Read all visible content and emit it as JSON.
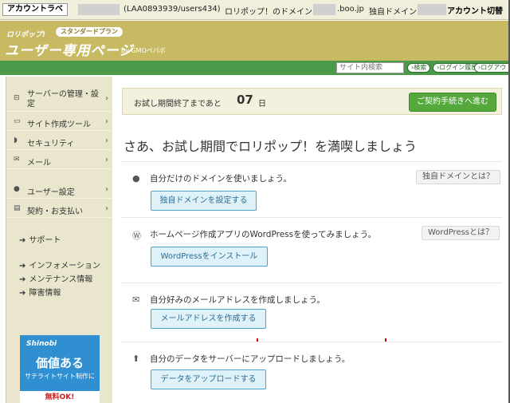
{
  "account_bar": {
    "tag": "アカウントラベ",
    "path": "(LAA0893939/users434)",
    "domain_label": "ロリポップ！のドメイン",
    "domain_suffix": ".boo.jp",
    "own_domain_label": "独自ドメイン",
    "switch_label": "アカウント切替"
  },
  "header": {
    "logo_small": "ロリポップ!",
    "plan_badge": "スタンダードプラン",
    "logo_main": "ユーザー専用ページ",
    "logo_gmo": "by GMOペパボ"
  },
  "toolbar": {
    "search_placeholder": "サイト内検索",
    "search_button": "検索",
    "login_history_button": "ログイン履歴",
    "logout_button": "ログアウト"
  },
  "sidebar": {
    "items": [
      {
        "icon": "server-icon",
        "label": "サーバーの管理・設定"
      },
      {
        "icon": "monitor-icon",
        "label": "サイト作成ツール"
      },
      {
        "icon": "shield-icon",
        "label": "セキュリティ"
      },
      {
        "icon": "mail-icon",
        "label": "メール"
      },
      {
        "icon": "user-icon",
        "label": "ユーザー設定"
      },
      {
        "icon": "card-icon",
        "label": "契約・お支払い"
      }
    ],
    "links": [
      "サポート",
      "インフォメーション",
      "メンテナンス情報",
      "障害情報"
    ],
    "banner": {
      "logo": "Shinobi",
      "title": "価値ある",
      "sub": "サテライトサイト制作に",
      "bottom": "無料OK!"
    }
  },
  "main": {
    "trial": {
      "label": "お試し期間終了まであと",
      "days": "07",
      "unit": "日",
      "contract_button": "ご契約手続きへ進む"
    },
    "headline": "さあ、お試し期間でロリポップ！を満喫しましょう",
    "cards": [
      {
        "icon": "globe-icon",
        "text": "自分だけのドメインを使いましょう。",
        "help": "独自ドメインとは？",
        "button": "独自ドメインを設定する"
      },
      {
        "icon": "wordpress-icon",
        "text": "ホームページ作成アプリのWordPressを使ってみましょう。",
        "help": "WordPressとは？",
        "button": "WordPressをインストール"
      },
      {
        "icon": "envelope-icon",
        "text": "自分好みのメールアドレスを作成しましょう。",
        "help": "",
        "button": "メールアドレスを作成する"
      },
      {
        "icon": "upload-icon",
        "text": "自分のデータをサーバーにアップロードしましょう。",
        "help": "",
        "button": "データをアップロードする"
      }
    ]
  }
}
